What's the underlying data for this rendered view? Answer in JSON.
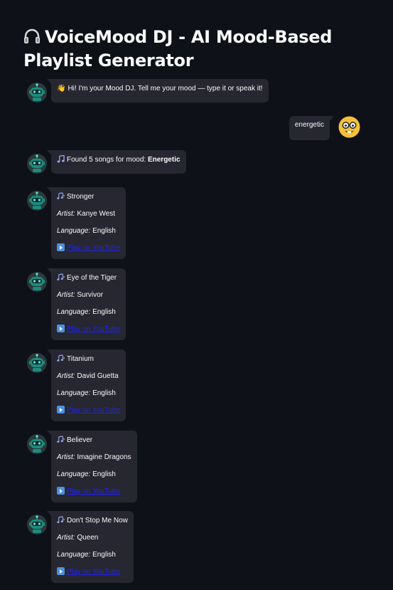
{
  "header": {
    "icon": "headphones-icon",
    "title": "VoiceMood DJ - AI Mood-Based Playlist Generator"
  },
  "messages": {
    "welcome": {
      "emoji": "👋",
      "text": "Hi! I'm your Mood DJ. Tell me your mood — type it or speak it!"
    },
    "user": {
      "text": "energetic"
    },
    "found": {
      "prefix": "Found 5 songs for mood: ",
      "mood": "Energetic"
    }
  },
  "labels": {
    "artist": "Artist:",
    "language": "Language:",
    "play": "Play on YouTube"
  },
  "songs": [
    {
      "title": "Stronger",
      "artist": "Kanye West",
      "language": "English"
    },
    {
      "title": "Eye of the Tiger",
      "artist": "Survivor",
      "language": "English"
    },
    {
      "title": "Titanium",
      "artist": "David Guetta",
      "language": "English"
    },
    {
      "title": "Believer",
      "artist": "Imagine Dragons",
      "language": "English"
    },
    {
      "title": "Don't Stop Me Now",
      "artist": "Queen",
      "language": "English"
    }
  ],
  "colors": {
    "background": "#0e1117",
    "bubble": "#262730",
    "text": "#fafafa",
    "link": "#2020ff",
    "bot_avatar": "#1f8a80",
    "user_avatar": "#f5c13a"
  }
}
